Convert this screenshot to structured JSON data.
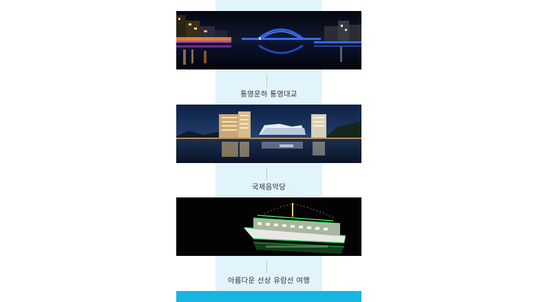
{
  "gallery": {
    "items": [
      {
        "caption": "통영운하 통영대교",
        "image": "night-bridge-canal-photo"
      },
      {
        "caption": "국제음악당",
        "image": "concert-hall-harbor-photo"
      },
      {
        "caption": "아름다운 선상 유람선 여행",
        "image": "illuminated-cruise-ship-photo"
      }
    ]
  },
  "colors": {
    "band": "#e2f4fb",
    "accent_bar": "#16b6e3",
    "caption_text": "#333333"
  }
}
